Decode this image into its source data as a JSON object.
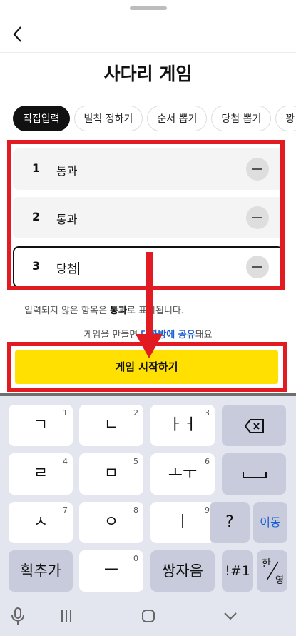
{
  "header": {
    "title": "사다리 게임"
  },
  "tabs": [
    {
      "label": "직접입력",
      "active": true
    },
    {
      "label": "벌칙 정하기"
    },
    {
      "label": "순서 뽑기"
    },
    {
      "label": "당첨 뽑기"
    },
    {
      "label": "꽝"
    }
  ],
  "items": [
    {
      "num": "1",
      "text": "통과"
    },
    {
      "num": "2",
      "text": "통과"
    },
    {
      "num": "3",
      "text": "당첨"
    }
  ],
  "info": {
    "line1_a": "입력되지 않은 항목은 ",
    "line1_b": "통과",
    "line1_c": "로 표시됩니다.",
    "line2_a": "게임을 만들면 ",
    "line2_b": "대화방에 공유",
    "line2_c": "돼요"
  },
  "start_button": "게임 시작하기",
  "keyboard": {
    "row1": [
      {
        "label": "ㄱ",
        "num": "1"
      },
      {
        "label": "ㄴ",
        "num": "2"
      },
      {
        "label": "ㅏㅓ",
        "num": "3"
      }
    ],
    "row2": [
      {
        "label": "ㄹ",
        "num": "4"
      },
      {
        "label": "ㅁ",
        "num": "5"
      },
      {
        "label": "ㅗㅜ",
        "num": "6"
      }
    ],
    "row3": [
      {
        "label": "ㅅ",
        "num": "7"
      },
      {
        "label": "ㅇ",
        "num": "8"
      },
      {
        "label": "ㅣ",
        "num": "9"
      }
    ],
    "row4": [
      {
        "label": "ㅡ",
        "num": "0"
      }
    ],
    "question": "?",
    "move": "이동",
    "add_stroke": "획추가",
    "double_consonant": "쌍자음",
    "symbols": "!#1",
    "lang_top": "한",
    "lang_bottom": "영"
  },
  "colors": {
    "highlight": "#e21b22",
    "start_bg": "#ffe000",
    "link": "#1a5fd4"
  }
}
